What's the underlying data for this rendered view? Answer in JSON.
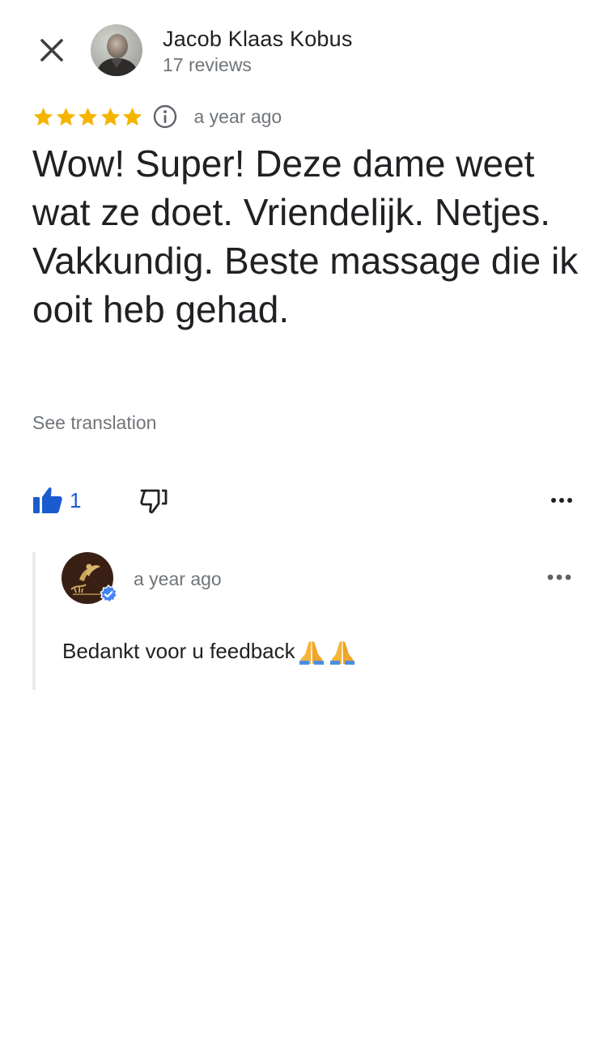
{
  "header": {
    "author_name": "Jacob Klaas Kobus",
    "author_review_count": "17 reviews",
    "close_icon": "close-icon",
    "avatar_icon": "profile-photo"
  },
  "review": {
    "rating": 5,
    "rating_max": 5,
    "star_color": "#f4b400",
    "info_icon": "info-icon",
    "date": "a year ago",
    "text": "Wow! Super! Deze dame weet wat ze doet. Vriendelijk. Netjes. Vakkundig. Beste massage die ik ooit heb gehad.",
    "see_translation": "See translation"
  },
  "actions": {
    "like_count": "1",
    "like_color": "#1a5ccf",
    "like_icon": "thumbs-up-icon",
    "dislike_icon": "thumbs-down-icon",
    "more_icon": "more-horizontal-icon"
  },
  "owner_reply": {
    "logo_icon": "business-logo",
    "verified_icon": "verified-check-icon",
    "verified_color": "#4285f4",
    "date": "a year ago",
    "more_icon": "more-horizontal-icon",
    "text": "Bedankt voor u feedback",
    "emojis": [
      "folded-hands-emoji",
      "folded-hands-emoji"
    ]
  }
}
